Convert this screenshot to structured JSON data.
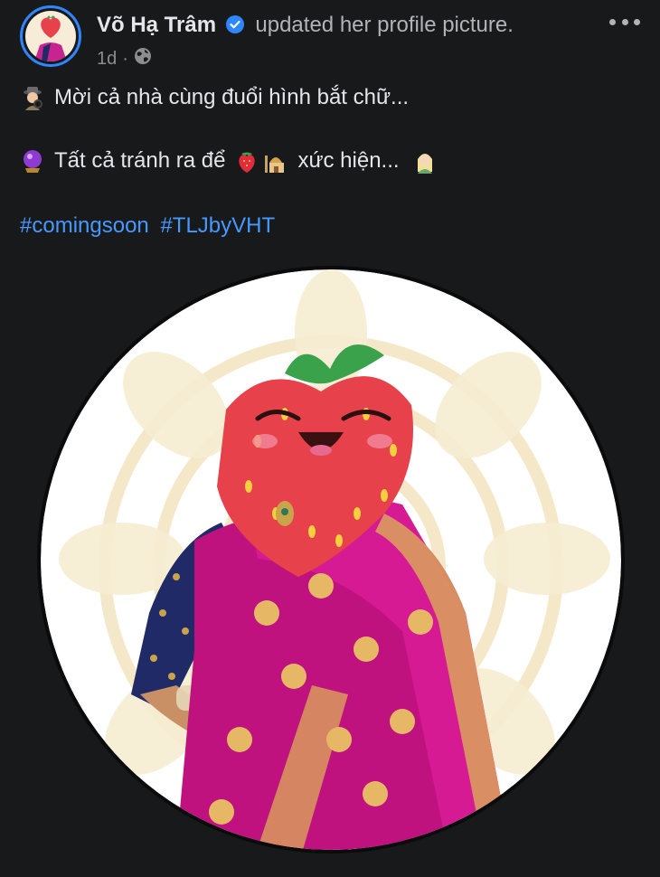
{
  "post": {
    "author": "Võ Hạ Trâm",
    "action": "updated her profile picture.",
    "time": "1d",
    "separator": "·",
    "audience_icon": "globe-icon",
    "verified_icon": "verified-badge-icon",
    "lines": [
      {
        "text": "Mời cả nhà cùng đuổi hình bắt chữ..."
      },
      {
        "text_before": "Tất cả tránh ra để",
        "text_after": "xức hiện..."
      }
    ],
    "hashtags": [
      "#comingsoon",
      "#TLJbyVHT"
    ]
  },
  "colors": {
    "background": "#18191b",
    "link": "#4599ff",
    "verified": "#2d88ff",
    "text": "#e4e6eb",
    "muted": "#8a8d91"
  }
}
